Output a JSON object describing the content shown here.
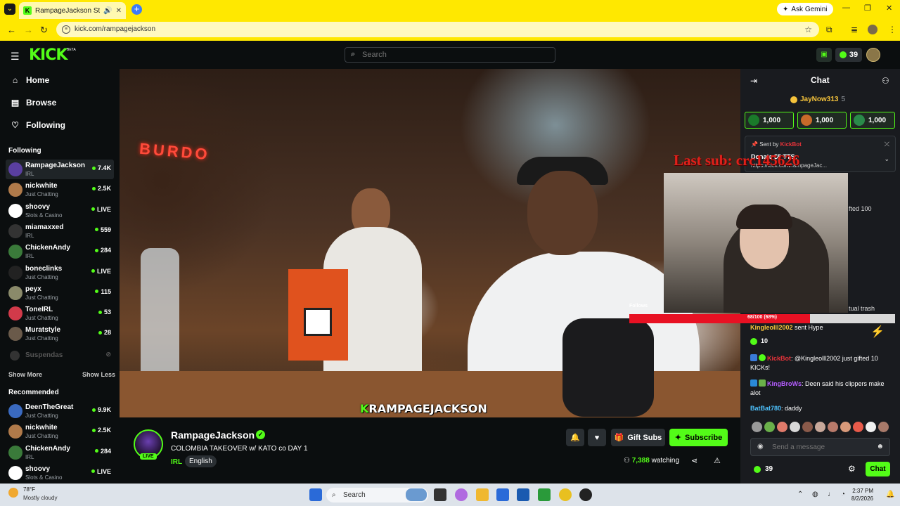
{
  "browser": {
    "tab_title": "RampageJackson Stream - ",
    "url": "kick.com/rampagejackson",
    "ask_gemini": "Ask Gemini"
  },
  "header": {
    "search_placeholder": "Search",
    "coins": "39"
  },
  "sidebar": {
    "nav": [
      {
        "label": "Home",
        "icon": "home-icon"
      },
      {
        "label": "Browse",
        "icon": "browse-icon"
      },
      {
        "label": "Following",
        "icon": "heart-icon"
      }
    ],
    "following_title": "Following",
    "following": [
      {
        "name": "RampageJackson",
        "category": "IRL",
        "viewers": "7.4K",
        "color": "#5a3fa0"
      },
      {
        "name": "nickwhite",
        "category": "Just Chatting",
        "viewers": "2.5K",
        "color": "#b07a4a"
      },
      {
        "name": "shoovy",
        "category": "Slots & Casino",
        "viewers": "LIVE",
        "color": "#ffffff"
      },
      {
        "name": "miamaxxed",
        "category": "IRL",
        "viewers": "559",
        "color": "#333333"
      },
      {
        "name": "ChickenAndy",
        "category": "IRL",
        "viewers": "284",
        "color": "#3a7a3a"
      },
      {
        "name": "boneclinks",
        "category": "Just Chatting",
        "viewers": "LIVE",
        "color": "#222222"
      },
      {
        "name": "peyx",
        "category": "Just Chatting",
        "viewers": "115",
        "color": "#8a8a6a"
      },
      {
        "name": "ToneIRL",
        "category": "Just Chatting",
        "viewers": "53",
        "color": "#d23a4a"
      },
      {
        "name": "Muratstyle",
        "category": "Just Chatting",
        "viewers": "28",
        "color": "#6a5a4a"
      }
    ],
    "offline": {
      "name": "Suspendas"
    },
    "show_more": "Show More",
    "show_less": "Show Less",
    "recommended_title": "Recommended",
    "recommended": [
      {
        "name": "DeenTheGreat",
        "category": "Just Chatting",
        "viewers": "9.9K",
        "color": "#3a6ac0"
      },
      {
        "name": "nickwhite",
        "category": "Just Chatting",
        "viewers": "2.5K",
        "color": "#b07a4a"
      },
      {
        "name": "ChickenAndy",
        "category": "IRL",
        "viewers": "284",
        "color": "#3a7a3a"
      },
      {
        "name": "shoovy",
        "category": "Slots & Casino",
        "viewers": "LIVE",
        "color": "#ffffff"
      }
    ]
  },
  "video": {
    "sign": "BURDO",
    "watermark_k": "K",
    "watermark_rest": "RAMPAGEJACKSON",
    "last_sub": "Last sub: crc145626",
    "follows_label": "Follows",
    "follows_goal": "68/100 (68%)",
    "follows_fraction": 0.68
  },
  "stream": {
    "name": "RampageJackson",
    "live": "LIVE",
    "title": "COLOMBIA TAKEOVER w/ KATO co  DAY 1",
    "category": "IRL",
    "language": "English",
    "gift_subs": "Gift Subs",
    "subscribe": "Subscribe",
    "watching_count": "7,388",
    "watching_label": "watching"
  },
  "chat": {
    "title": "Chat",
    "pinned_user": "JayNow313",
    "pinned_user_count": "5",
    "kick_cards": [
      "1,000",
      "1,000",
      "1,000"
    ],
    "pinned_sent_by": "Sent by",
    "pinned_bot": "KickBot",
    "pinned_msg": "Donate $5 TTS:",
    "pinned_url": "https://kick.com/rampageJac...",
    "partial_gifted": "fted 100",
    "partial_trash": "tual trash",
    "hype_user": "Kingleolll2002",
    "hype_text": "sent Hype",
    "hype_amount": "10",
    "messages": [
      {
        "user": "KickBot",
        "text": ": @Kingleolll2002 just gifted 10 KICKs!"
      },
      {
        "user": "KingBroWs",
        "text": ": Deen said his clippers make alot"
      },
      {
        "user": "BatBat780",
        "text": ": daddy"
      }
    ],
    "input_placeholder": "Send a message",
    "coins": "39",
    "send": "Chat"
  },
  "taskbar": {
    "temp": "78°F",
    "condition": "Mostly cloudy",
    "search": "Search",
    "time": "2:37 PM",
    "date": "8/2/2026"
  }
}
